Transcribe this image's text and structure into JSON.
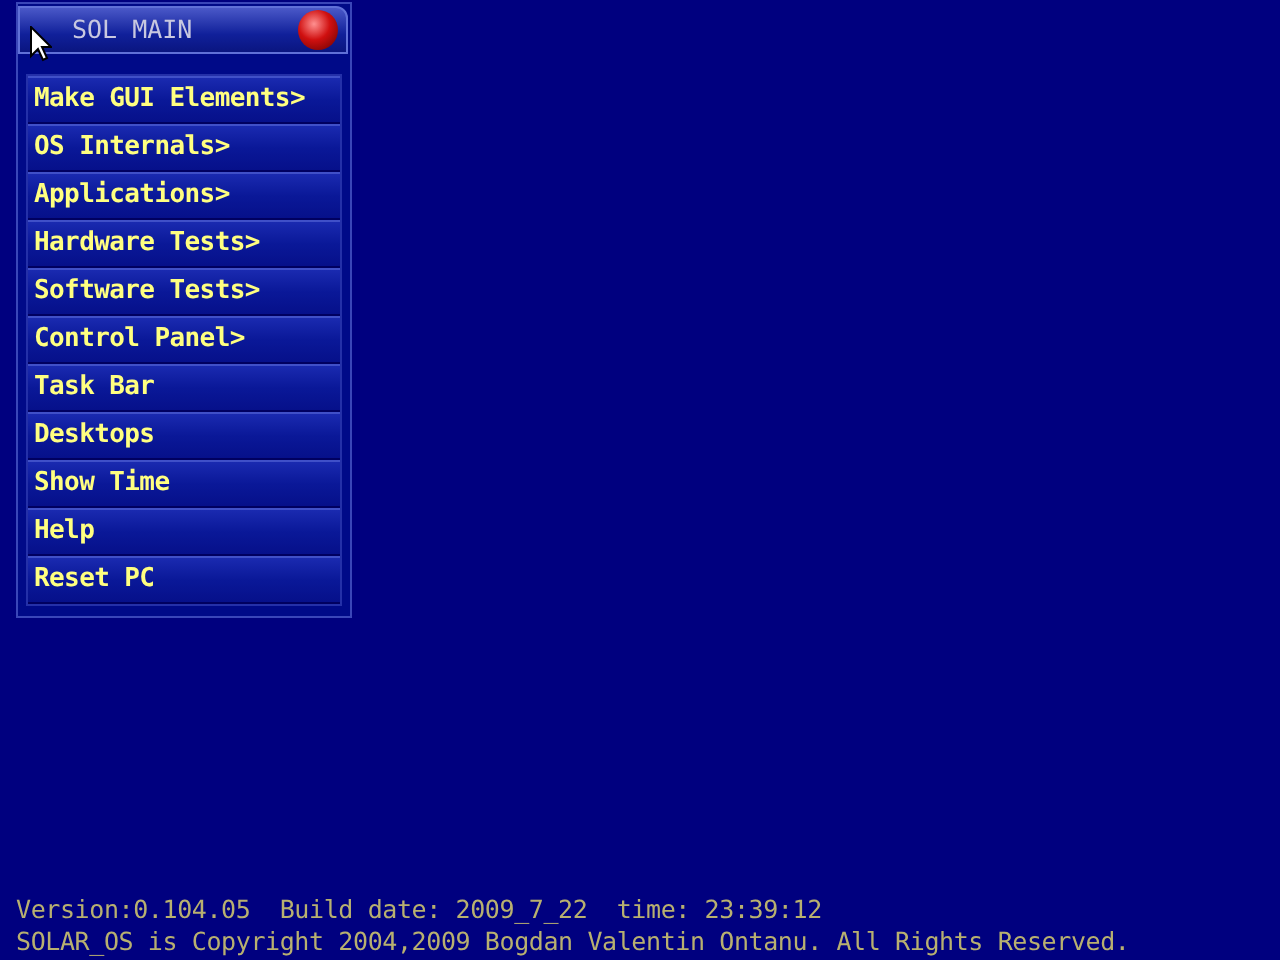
{
  "menu": {
    "title": "SOL MAIN",
    "items": [
      {
        "label": "Make GUI Elements>"
      },
      {
        "label": "OS Internals>"
      },
      {
        "label": "Applications>"
      },
      {
        "label": "Hardware Tests>"
      },
      {
        "label": "Software Tests>"
      },
      {
        "label": "Control Panel>"
      },
      {
        "label": "Task Bar"
      },
      {
        "label": "Desktops"
      },
      {
        "label": "Show Time"
      },
      {
        "label": "Help"
      },
      {
        "label": "Reset PC"
      }
    ]
  },
  "status_lines": [
    "Version:0.104.05  Build date: 2009_7_22  time: 23:39:12",
    "SOLAR_OS is Copyright 2004,2009 Bogdan Valentin Ontanu. All Rights Reserved."
  ]
}
